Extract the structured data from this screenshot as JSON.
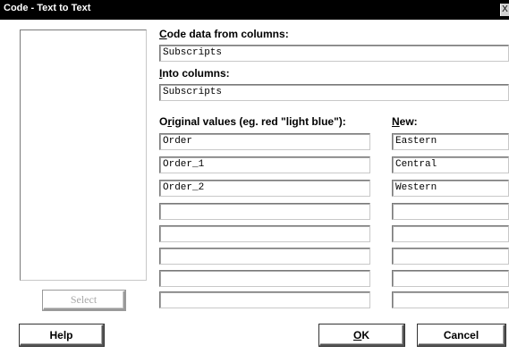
{
  "window": {
    "title": "Code - Text to Text",
    "close_glyph": "X"
  },
  "select_button": "Select",
  "code_from": {
    "label_key": "C",
    "label_rest": "ode data from columns:",
    "value": "Subscripts"
  },
  "into": {
    "label_key": "I",
    "label_rest": "nto columns:",
    "value": "Subscripts"
  },
  "original": {
    "label_pre": "O",
    "label_key": "r",
    "label_rest": "iginal values (eg.  red  \"light blue\"):",
    "values": [
      "Order",
      "Order_1",
      "Order_2",
      "",
      "",
      "",
      "",
      ""
    ]
  },
  "new": {
    "label_key": "N",
    "label_rest": "ew:",
    "values": [
      "Eastern",
      "Central",
      "Western",
      "",
      "",
      "",
      "",
      ""
    ]
  },
  "buttons": {
    "help": "Help",
    "ok_key": "O",
    "ok_rest": "K",
    "cancel": "Cancel"
  }
}
